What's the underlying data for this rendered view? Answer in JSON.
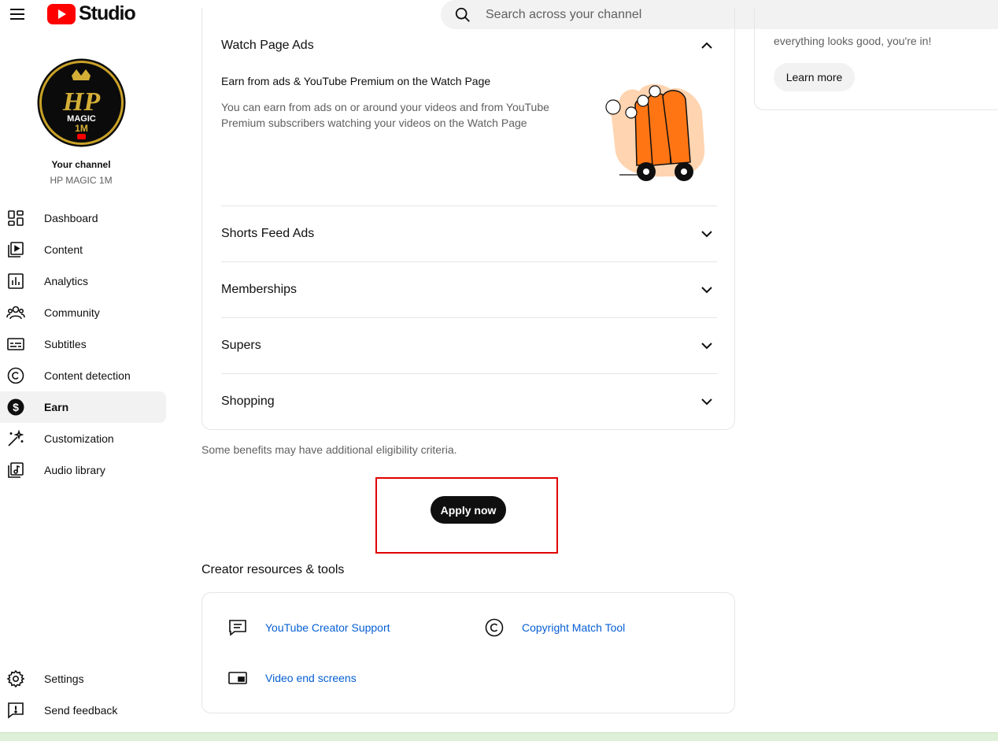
{
  "header": {
    "app_name": "Studio",
    "search_placeholder": "Search across your channel"
  },
  "sidebar": {
    "channel_label": "Your channel",
    "channel_name": "HP MAGIC 1M",
    "avatar_text": "HP MAGIC 1M",
    "items": [
      {
        "label": "Dashboard",
        "icon": "dashboard-icon"
      },
      {
        "label": "Content",
        "icon": "content-icon"
      },
      {
        "label": "Analytics",
        "icon": "analytics-icon"
      },
      {
        "label": "Community",
        "icon": "community-icon"
      },
      {
        "label": "Subtitles",
        "icon": "subtitles-icon"
      },
      {
        "label": "Content detection",
        "icon": "copyright-icon"
      },
      {
        "label": "Earn",
        "icon": "dollar-icon",
        "active": true
      },
      {
        "label": "Customization",
        "icon": "magic-wand-icon"
      },
      {
        "label": "Audio library",
        "icon": "audio-library-icon"
      }
    ],
    "footer": [
      {
        "label": "Settings",
        "icon": "gear-icon"
      },
      {
        "label": "Send feedback",
        "icon": "feedback-icon"
      }
    ]
  },
  "main": {
    "expanded_section": {
      "title": "Watch Page Ads",
      "subtitle": "Earn from ads & YouTube Premium on the Watch Page",
      "description": "You can earn from ads on or around your videos and from YouTube Premium subscribers watching your videos on the Watch Page"
    },
    "sections": [
      "Shorts Feed Ads",
      "Memberships",
      "Supers",
      "Shopping"
    ],
    "benefits_note": "Some benefits may have additional eligibility criteria.",
    "apply_label": "Apply now",
    "resources_title": "Creator resources & tools",
    "resources": [
      {
        "label": "YouTube Creator Support",
        "icon": "chat-icon"
      },
      {
        "label": "Copyright Match Tool",
        "icon": "copyright-icon"
      },
      {
        "label": "Video end screens",
        "icon": "end-screen-icon"
      }
    ]
  },
  "right_panel": {
    "text": "everything looks good, you're in!",
    "learn_more_label": "Learn more"
  },
  "colors": {
    "brand_red": "#ff0000",
    "link_blue": "#065fd4",
    "highlight_red": "#e00000",
    "illustration_orange": "#ff7514"
  }
}
